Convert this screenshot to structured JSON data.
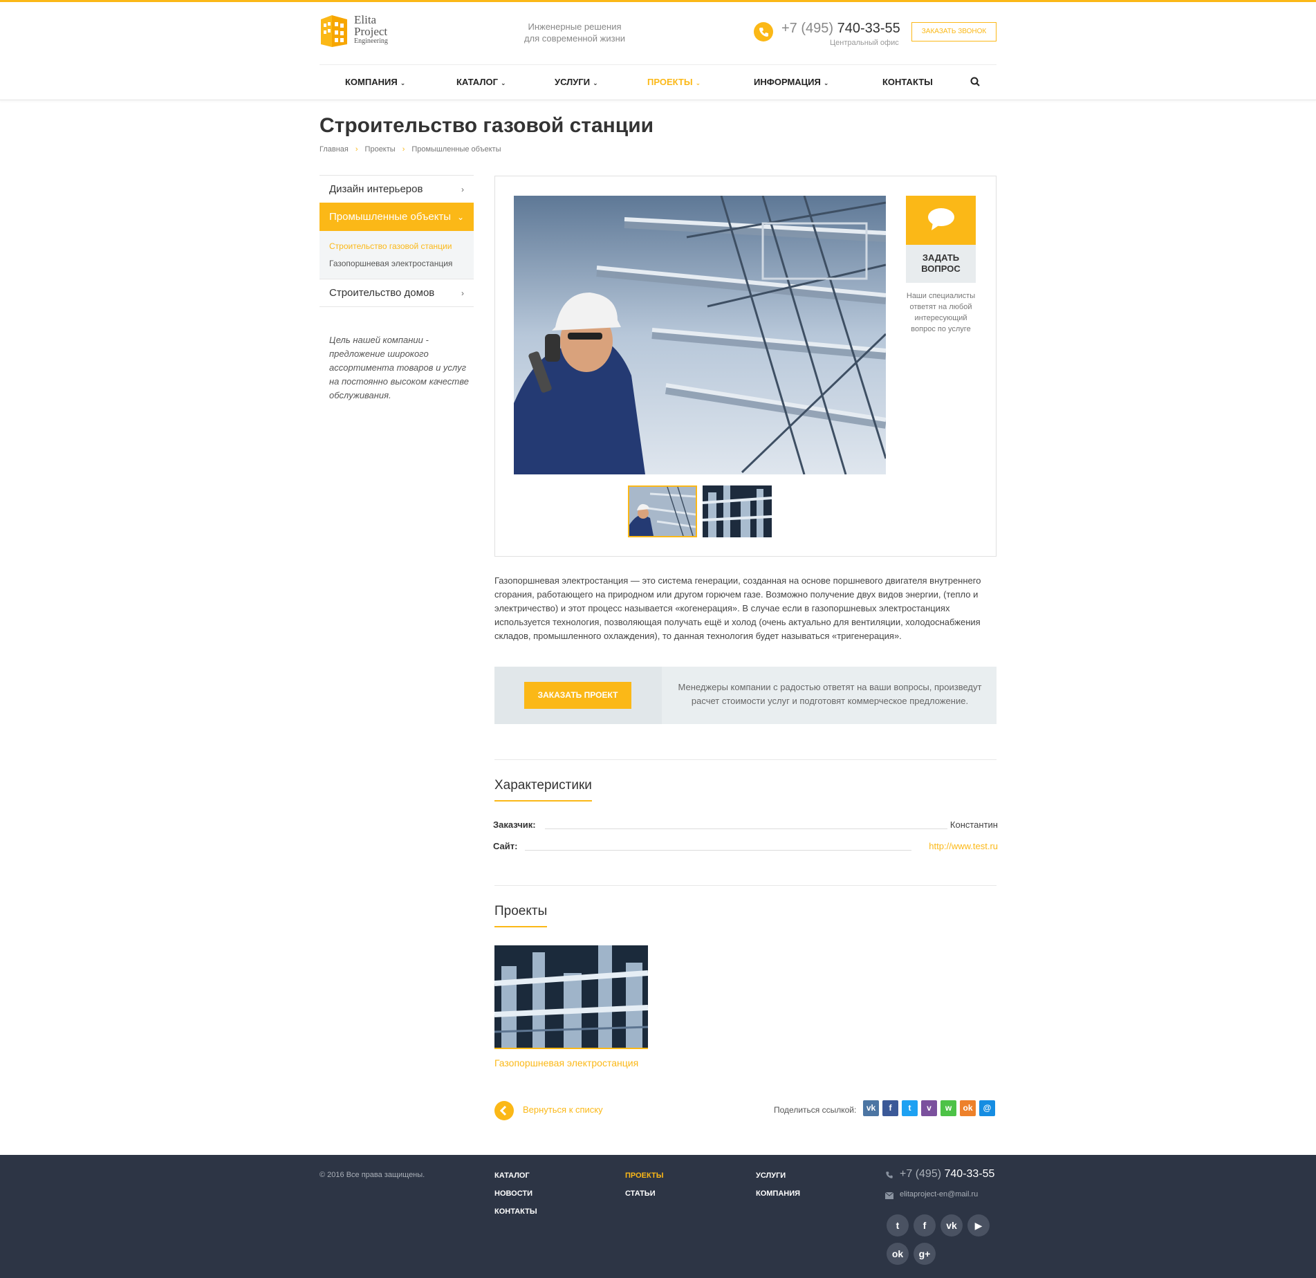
{
  "header": {
    "logo": {
      "line1": "Elita",
      "line2": "Project",
      "line3": "Engineering"
    },
    "slogan": {
      "line1": "Инженерные решения",
      "line2": "для современной жизни"
    },
    "phone": {
      "code": "+7 (495)",
      "number": "740-33-55",
      "sub": "Центральный офис"
    },
    "callback": "Заказать звонок"
  },
  "nav": [
    {
      "label": "Компания",
      "has_dropdown": true
    },
    {
      "label": "Каталог",
      "has_dropdown": true
    },
    {
      "label": "Услуги",
      "has_dropdown": true
    },
    {
      "label": "Проекты",
      "has_dropdown": true,
      "active": true
    },
    {
      "label": "Информация",
      "has_dropdown": true
    },
    {
      "label": "Контакты",
      "has_dropdown": false
    }
  ],
  "page": {
    "title": "Строительство газовой станции",
    "breadcrumb": [
      "Главная",
      "Проекты",
      "Промышленные объекты"
    ]
  },
  "sidebar": {
    "items": [
      {
        "label": "Дизайн интерьеров"
      },
      {
        "label": "Промышленные объекты",
        "active": true
      },
      {
        "label": "Строительство домов"
      }
    ],
    "sub": [
      "Строительство газовой станции",
      "Газопоршневая электростанция"
    ],
    "note": "Цель нашей компании - предложение широкого ассортимента товаров и услуг на постоянно высоком качестве обслуживания."
  },
  "ask": {
    "label_line1": "Задать",
    "label_line2": "вопрос",
    "note": "Наши специалисты ответят на любой интересующий вопрос по услуге"
  },
  "description": "Газопоршневая электростанция — это система генерации, созданная на основе поршневого двигателя внутреннего сгорания, работающего на природном или другом горючем газе. Возможно получение двух видов энергии, (тепло и электричество) и этот процесс называется «когенерация». В случае если в газопоршневых электростанциях используется технология, позволяющая получать ещё и холод (очень актуально для вентиляции, холодоснабжения складов, промышленного охлаждения), то данная технология будет называться «тригенерация».",
  "order": {
    "button": "Заказать проект",
    "text": "Менеджеры компании с радостью ответят на ваши вопросы, произведут расчет стоимости услуг и подготовят коммерческое предложение."
  },
  "characteristics": {
    "title": "Характеристики",
    "rows": [
      {
        "name": "Заказчик:",
        "value": "Константин"
      },
      {
        "name": "Сайт:",
        "value": "http://www.test.ru"
      }
    ]
  },
  "projects": {
    "title": "Проекты",
    "items": [
      {
        "name": "Газопоршневая электростанция"
      }
    ]
  },
  "back": "Вернуться к списку",
  "share": {
    "label": "Поделиться ссылкой:",
    "buttons": [
      {
        "icon": "vk-icon",
        "glyph": "vk",
        "color": "#4c75a3"
      },
      {
        "icon": "facebook-icon",
        "glyph": "f",
        "color": "#3b5998"
      },
      {
        "icon": "twitter-icon",
        "glyph": "t",
        "color": "#1da1f2"
      },
      {
        "icon": "viber-icon",
        "glyph": "v",
        "color": "#7b519d"
      },
      {
        "icon": "whatsapp-icon",
        "glyph": "w",
        "color": "#4dc247"
      },
      {
        "icon": "odnoklassniki-icon",
        "glyph": "ok",
        "color": "#ed812b"
      },
      {
        "icon": "moimir-icon",
        "glyph": "@",
        "color": "#168de2"
      }
    ]
  },
  "footer": {
    "copyright": "© 2016 Все права защищены.",
    "links": [
      {
        "label": "Каталог"
      },
      {
        "label": "Проекты",
        "active": true
      },
      {
        "label": "Услуги"
      },
      {
        "label": "Новости"
      },
      {
        "label": "Статьи"
      },
      {
        "label": "Компания"
      },
      {
        "label": "Контакты"
      }
    ],
    "phone": {
      "code": "+7 (495)",
      "number": "740-33-55"
    },
    "email": "elitaproject-en@mail.ru",
    "social": [
      {
        "icon": "twitter-icon",
        "glyph": "t"
      },
      {
        "icon": "facebook-icon",
        "glyph": "f"
      },
      {
        "icon": "vk-icon",
        "glyph": "vk"
      },
      {
        "icon": "youtube-icon",
        "glyph": "▶"
      },
      {
        "icon": "odnoklassniki-icon",
        "glyph": "ok"
      },
      {
        "icon": "googleplus-icon",
        "glyph": "g+"
      }
    ]
  },
  "colors": {
    "accent": "#fbb817",
    "footer_bg": "#2d3545"
  }
}
